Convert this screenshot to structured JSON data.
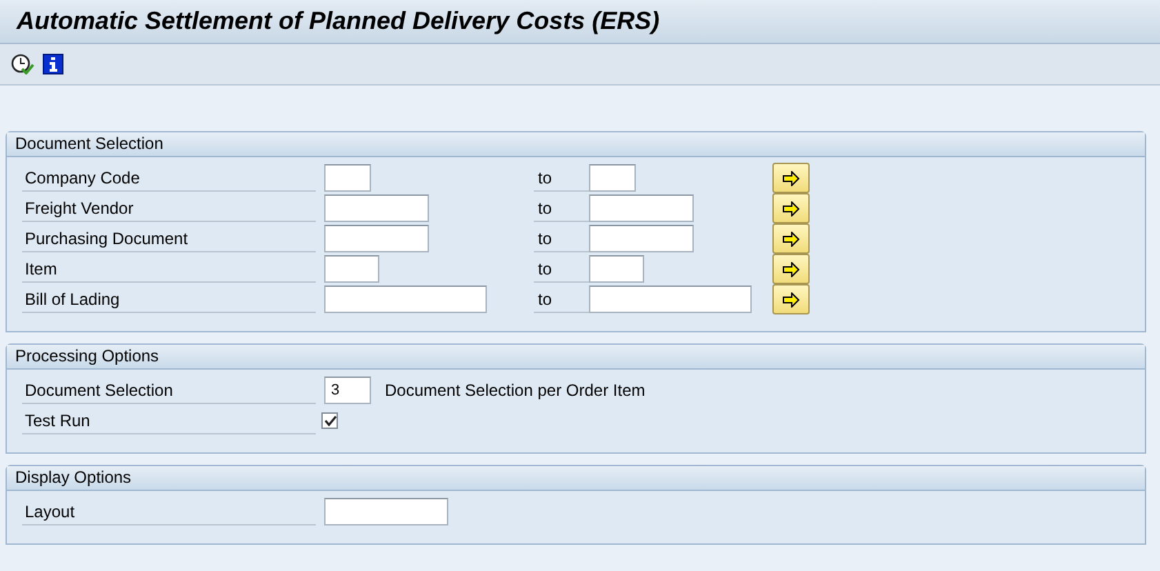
{
  "window": {
    "title": "Automatic Settlement of Planned Delivery Costs (ERS)"
  },
  "sections": [
    {
      "title": "Document Selection",
      "rows": [
        {
          "kind": "range",
          "label": "Company Code",
          "to_label": "to"
        },
        {
          "kind": "range",
          "label": "Freight Vendor",
          "to_label": "to"
        },
        {
          "kind": "range",
          "label": "Purchasing Document",
          "to_label": "to"
        },
        {
          "kind": "range",
          "label": "Item",
          "to_label": "to"
        },
        {
          "kind": "range",
          "label": "Bill of Lading",
          "to_label": "to"
        }
      ]
    },
    {
      "title": "Processing Options",
      "rows": [
        {
          "kind": "field",
          "label": "Document Selection",
          "value": "3",
          "description": "Document Selection per Order Item"
        },
        {
          "kind": "checkbox",
          "label": "Test Run",
          "checked": true
        }
      ]
    },
    {
      "title": "Display Options",
      "rows": [
        {
          "kind": "field",
          "label": "Layout",
          "value": ""
        }
      ]
    }
  ]
}
